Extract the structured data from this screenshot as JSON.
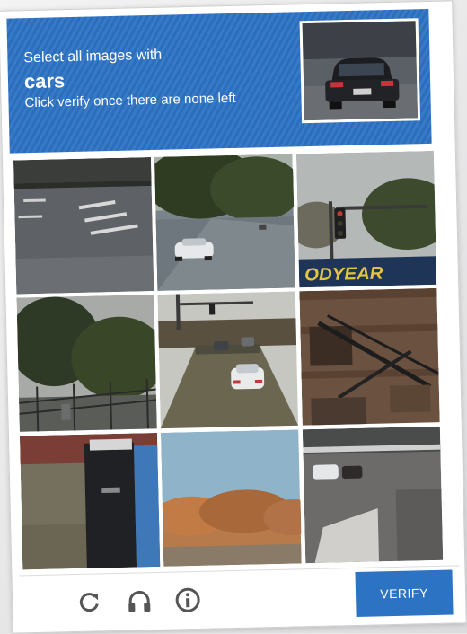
{
  "challenge": {
    "instruction": "Select all images with",
    "target": "cars",
    "subtext": "Click verify once there are none left"
  },
  "tiles": [
    {
      "name": "tile-road-crosswalk"
    },
    {
      "name": "tile-street-white-car"
    },
    {
      "name": "tile-traffic-light-goodyear"
    },
    {
      "name": "tile-trees-fence"
    },
    {
      "name": "tile-street-traffic"
    },
    {
      "name": "tile-building-fire-escape"
    },
    {
      "name": "tile-dumpster"
    },
    {
      "name": "tile-autumn-trees"
    },
    {
      "name": "tile-parking-lot"
    }
  ],
  "sign_text": "ODYEAR",
  "footer": {
    "verify_label": "VERIFY",
    "icons": [
      "reload-icon",
      "audio-icon",
      "info-icon"
    ]
  },
  "colors": {
    "accent": "#2d73c4",
    "background": "#ffffff"
  }
}
